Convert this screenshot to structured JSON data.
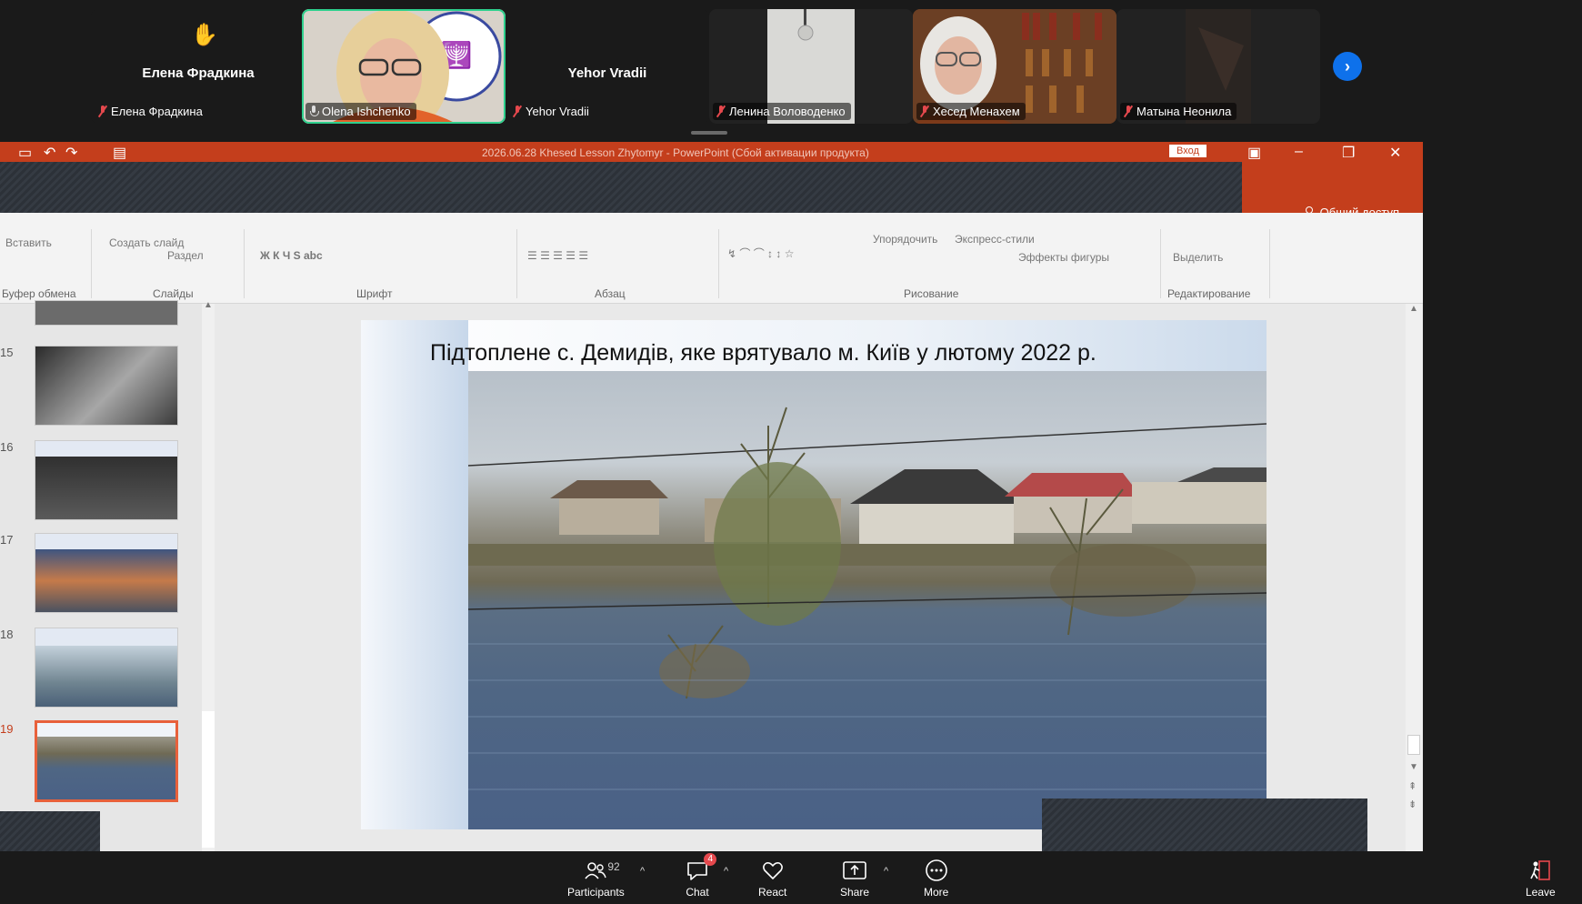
{
  "participants": [
    {
      "display_name": "Елена Фрадкина",
      "label": "Елена Фрадкина",
      "raised_hand": true
    },
    {
      "display_name": "",
      "label": "Olena Ishchenko",
      "active_speaker": true
    },
    {
      "display_name": "Yehor Vradii",
      "label": "Yehor Vradii"
    },
    {
      "display_name": "",
      "label": "Ленина Воловоденко"
    },
    {
      "display_name": "",
      "label": "Хесед Менахем"
    },
    {
      "display_name": "",
      "label": "Матына Неонила"
    }
  ],
  "screen_share": {
    "window_title": "2026.06.28 Khesed Lesson Zhytomyr - PowerPoint (Сбой активации продукта)",
    "sign_in": "Вход",
    "share_button": "Общий доступ",
    "ribbon_groups": [
      "Буфер обмена",
      "Слайды",
      "Шрифт",
      "Абзац",
      "Рисование",
      "Редактирование"
    ],
    "ribbon_items": {
      "paste": "Вставить",
      "new_slide": "Создать слайд",
      "section": "Раздел",
      "arrange": "Упорядочить",
      "quick_styles": "Экспресс-стили",
      "shape_effects": "Эффекты фигуры",
      "select": "Выделить"
    },
    "slide_numbers": [
      "15",
      "16",
      "17",
      "18",
      "19"
    ],
    "selected_slide": "19",
    "slide_title": "Підтоплене с. Демидів, яке врятувало м. Київ у лютому 2022 р."
  },
  "toolbar": {
    "participants_label": "Participants",
    "participants_count": "92",
    "chat_label": "Chat",
    "chat_badge": "4",
    "react_label": "React",
    "share_label": "Share",
    "more_label": "More",
    "leave_label": "Leave"
  },
  "colors": {
    "powerpoint_accent": "#c43e1c",
    "active_speaker_border": "#2ed08d",
    "zoom_blue": "#0e71eb",
    "badge_red": "#e5484d"
  }
}
